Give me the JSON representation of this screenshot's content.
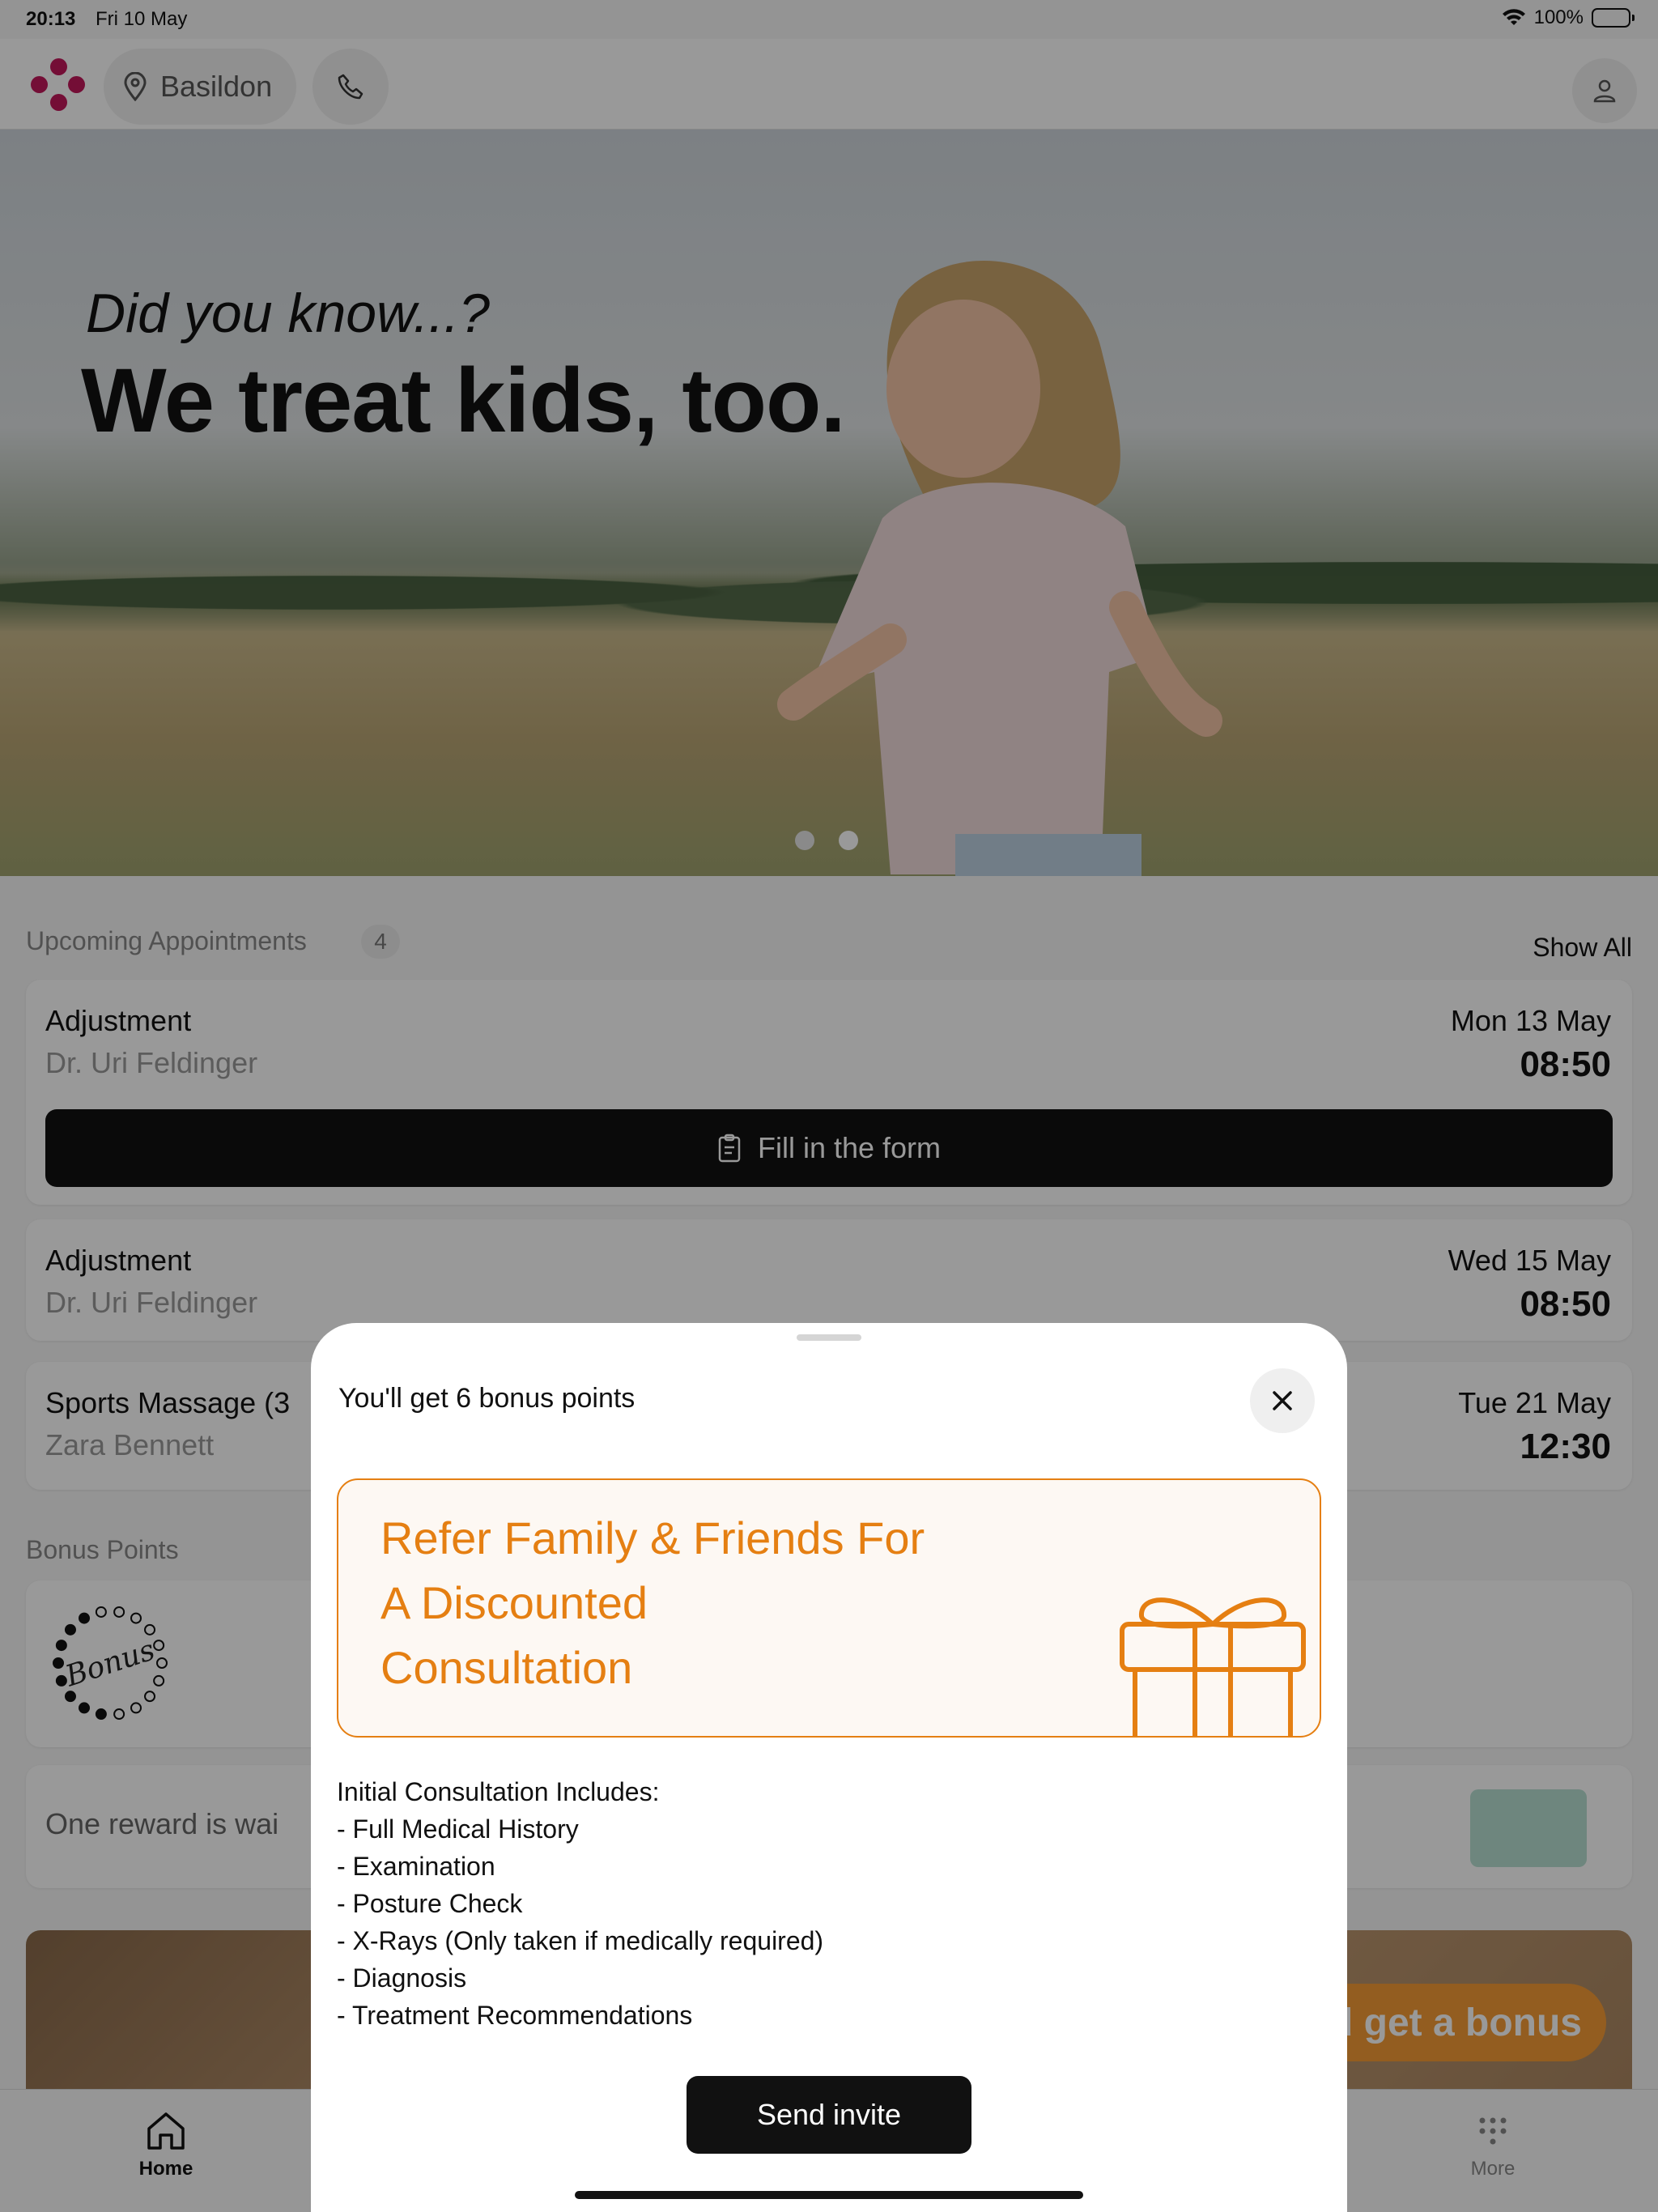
{
  "status_bar": {
    "time": "20:13",
    "date": "Fri 10 May",
    "battery": "100%"
  },
  "header": {
    "location": "Basildon"
  },
  "hero": {
    "kicker": "Did you know...?",
    "title": "We treat kids, too."
  },
  "appointments": {
    "section_label": "Upcoming Appointments",
    "count": "4",
    "show_all": "Show All",
    "items": [
      {
        "title": "Adjustment",
        "practitioner": "Dr. Uri Feldinger",
        "date": "Mon 13 May",
        "time": "08:50",
        "action": "Fill in the form"
      },
      {
        "title": "Adjustment",
        "practitioner": "Dr. Uri Feldinger",
        "date": "Wed 15 May",
        "time": "08:50"
      },
      {
        "title": "Sports Massage (3",
        "practitioner": "Zara Bennett",
        "date": "Tue 21 May",
        "time": "12:30"
      }
    ]
  },
  "bonus": {
    "section_label": "Bonus Points",
    "logo_text": "Bonus",
    "reward_text": "One reward is wai"
  },
  "promo": {
    "pill_text": "d get a bonus"
  },
  "tabbar": {
    "home": "Home",
    "more": "More"
  },
  "sheet": {
    "title": "You'll get 6 bonus points",
    "heading_lines": [
      "Refer Family & Friends For",
      "A Discounted",
      "Consultation"
    ],
    "includes_title": "Initial Consultation Includes:",
    "includes": [
      "- Full Medical History",
      "- Examination",
      "- Posture Check",
      "- X-Rays (Only taken if medically required)",
      "- Diagnosis",
      "- Treatment Recommendations"
    ],
    "send_label": "Send invite"
  },
  "colors": {
    "accent": "#e57f12",
    "brand": "#c2185b",
    "button": "#111111"
  }
}
